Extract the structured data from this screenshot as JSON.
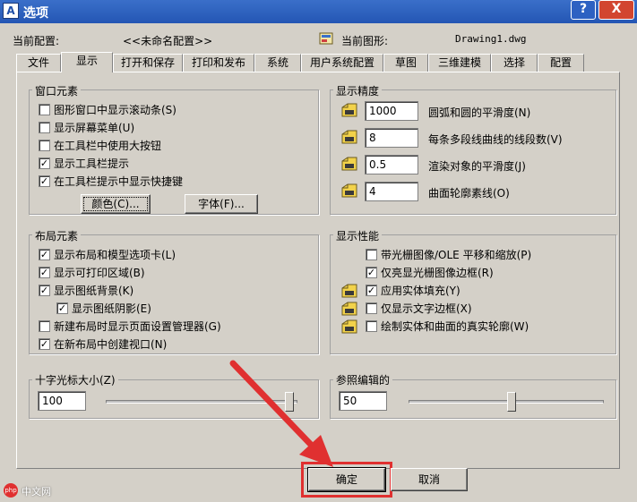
{
  "window": {
    "title": "选项",
    "app_icon_glyph": "A",
    "help_glyph": "?",
    "close_glyph": "X"
  },
  "header": {
    "profile_label": "当前配置:",
    "profile_value": "<<未命名配置>>",
    "drawing_label": "当前图形:",
    "drawing_value": "Drawing1.dwg"
  },
  "tabs": [
    {
      "label": "文件"
    },
    {
      "label": "显示"
    },
    {
      "label": "打开和保存"
    },
    {
      "label": "打印和发布"
    },
    {
      "label": "系统"
    },
    {
      "label": "用户系统配置"
    },
    {
      "label": "草图"
    },
    {
      "label": "三维建模"
    },
    {
      "label": "选择"
    },
    {
      "label": "配置"
    }
  ],
  "active_tab": "显示",
  "window_elements": {
    "title": "窗口元素",
    "checkboxes": [
      {
        "label": "图形窗口中显示滚动条(S)",
        "checked": false
      },
      {
        "label": "显示屏幕菜单(U)",
        "checked": false
      },
      {
        "label": "在工具栏中使用大按钮",
        "checked": false
      },
      {
        "label": "显示工具栏提示",
        "checked": true
      },
      {
        "label": "在工具栏提示中显示快捷键",
        "checked": true
      }
    ],
    "color_button": "颜色(C)...",
    "font_button": "字体(F)..."
  },
  "display_precision": {
    "title": "显示精度",
    "rows": [
      {
        "value": "1000",
        "label": "圆弧和圆的平滑度(N)"
      },
      {
        "value": "8",
        "label": "每条多段线曲线的线段数(V)"
      },
      {
        "value": "0.5",
        "label": "渲染对象的平滑度(J)"
      },
      {
        "value": "4",
        "label": "曲面轮廓素线(O)"
      }
    ]
  },
  "layout_elements": {
    "title": "布局元素",
    "checkboxes": [
      {
        "label": "显示布局和模型选项卡(L)",
        "checked": true
      },
      {
        "label": "显示可打印区域(B)",
        "checked": true
      },
      {
        "label": "显示图纸背景(K)",
        "checked": true
      },
      {
        "label": "显示图纸阴影(E)",
        "checked": true
      },
      {
        "label": "新建布局时显示页面设置管理器(G)",
        "checked": false
      },
      {
        "label": "在新布局中创建视口(N)",
        "checked": true
      }
    ]
  },
  "display_performance": {
    "title": "显示性能",
    "checkboxes": [
      {
        "label": "带光栅图像/OLE 平移和缩放(P)",
        "checked": false
      },
      {
        "label": "仅亮显光栅图像边框(R)",
        "checked": true
      },
      {
        "label": "应用实体填充(Y)",
        "checked": true
      },
      {
        "label": "仅显示文字边框(X)",
        "checked": false
      },
      {
        "label": "绘制实体和曲面的真实轮廓(W)",
        "checked": false
      }
    ]
  },
  "crosshair": {
    "title": "十字光标大小(Z)",
    "value": "100",
    "slider_fraction": 1.0
  },
  "xref_fade": {
    "title": "参照编辑的",
    "value": "50",
    "slider_fraction": 0.5
  },
  "buttons": {
    "ok": "确定",
    "cancel": "取消"
  },
  "watermark": {
    "text": "中文网",
    "badge": "php"
  },
  "colors": {
    "titlebar": "#2456b4",
    "dialog_bg": "#d4d0c8",
    "highlight_red": "#e03030",
    "close_red": "#d2452f"
  }
}
